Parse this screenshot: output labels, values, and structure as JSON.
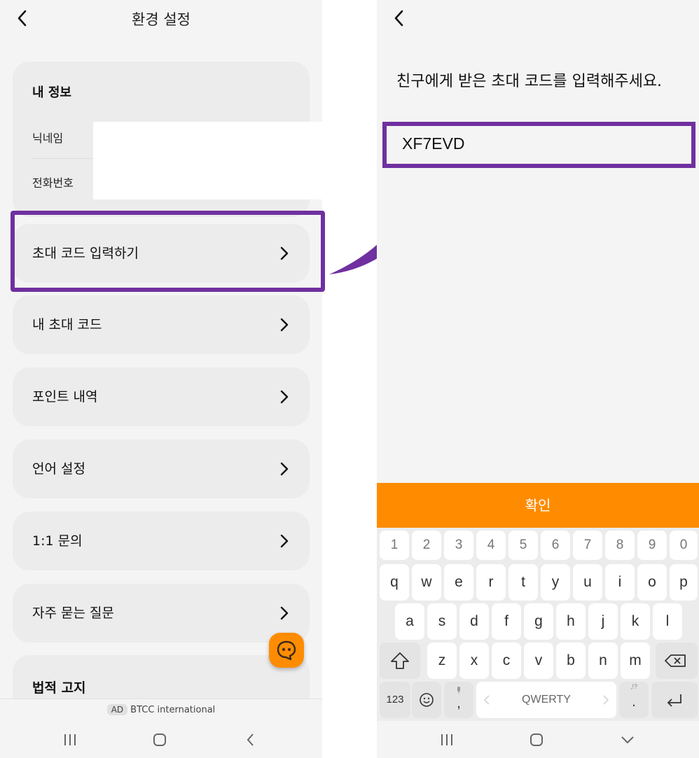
{
  "left_screen": {
    "header": {
      "title": "환경 설정"
    },
    "profile": {
      "title": "내 정보",
      "nickname_label": "닉네임",
      "phone_label": "전화번호"
    },
    "menu": [
      {
        "label": "초대 코드 입력하기"
      },
      {
        "label": "내 초대 코드"
      },
      {
        "label": "포인트 내역"
      },
      {
        "label": "언어 설정"
      },
      {
        "label": "1:1 문의"
      },
      {
        "label": "자주 묻는 질문"
      }
    ],
    "legal": {
      "title": "법적 고지"
    },
    "ad": {
      "badge": "AD",
      "text": "BTCC international"
    }
  },
  "right_screen": {
    "prompt": "친구에게 받은 초대 코드를 입력해주세요.",
    "code_input": {
      "value": "XF7EVD"
    },
    "confirm_label": "확인",
    "keyboard": {
      "numbers": [
        "1",
        "2",
        "3",
        "4",
        "5",
        "6",
        "7",
        "8",
        "9",
        "0"
      ],
      "row1": [
        "q",
        "w",
        "e",
        "r",
        "t",
        "y",
        "u",
        "i",
        "o",
        "p"
      ],
      "row2": [
        "a",
        "s",
        "d",
        "f",
        "g",
        "h",
        "j",
        "k",
        "l"
      ],
      "row3": [
        "z",
        "x",
        "c",
        "v",
        "b",
        "n",
        "m"
      ],
      "symbols_key": "123",
      "space_label": "QWERTY",
      "comma": ",",
      "period": ".",
      "period_sub": ",!?"
    }
  },
  "colors": {
    "accent_orange": "#ff8c00",
    "highlight_purple": "#7030a0",
    "background": "#f4f4f4"
  }
}
